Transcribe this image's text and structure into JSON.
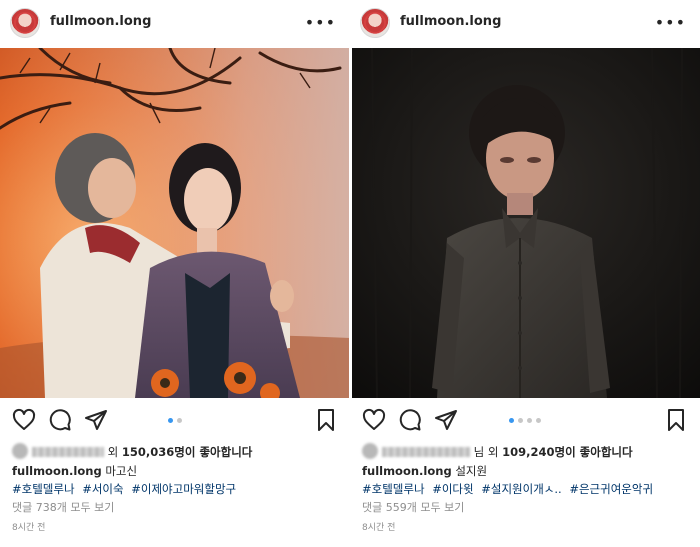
{
  "posts": [
    {
      "username": "fullmoon.long",
      "likes_suffix": "외",
      "likes_count": "150,036명이 좋아합니다",
      "caption_user": "fullmoon.long",
      "caption_text": "마고신",
      "hashtags": [
        "#호텔델루나",
        "#서이숙",
        "#이제야고마워할망구"
      ],
      "comments_link": "댓글 738개 모두 보기",
      "timestamp": "8시간 전",
      "carousel": {
        "total": 2,
        "active": 0
      }
    },
    {
      "username": "fullmoon.long",
      "likes_suffix": "님 외",
      "likes_count": "109,240명이 좋아합니다",
      "caption_user": "fullmoon.long",
      "caption_text": "설지원",
      "hashtags": [
        "#호텔델루나",
        "#이다윗",
        "#설지원이개ㅅ..",
        "#은근귀여운악귀"
      ],
      "comments_link": "댓글 559개 모두 보기",
      "timestamp": "8시간 전",
      "carousel": {
        "total": 4,
        "active": 0
      }
    }
  ],
  "icons": {
    "more": "more-options-icon",
    "heart": "heart-icon",
    "comment": "comment-icon",
    "share": "share-icon",
    "bookmark": "bookmark-icon"
  },
  "colors": {
    "hashtag": "#003569",
    "carousel_active": "#3897f0",
    "muted": "#8e8e8e"
  }
}
